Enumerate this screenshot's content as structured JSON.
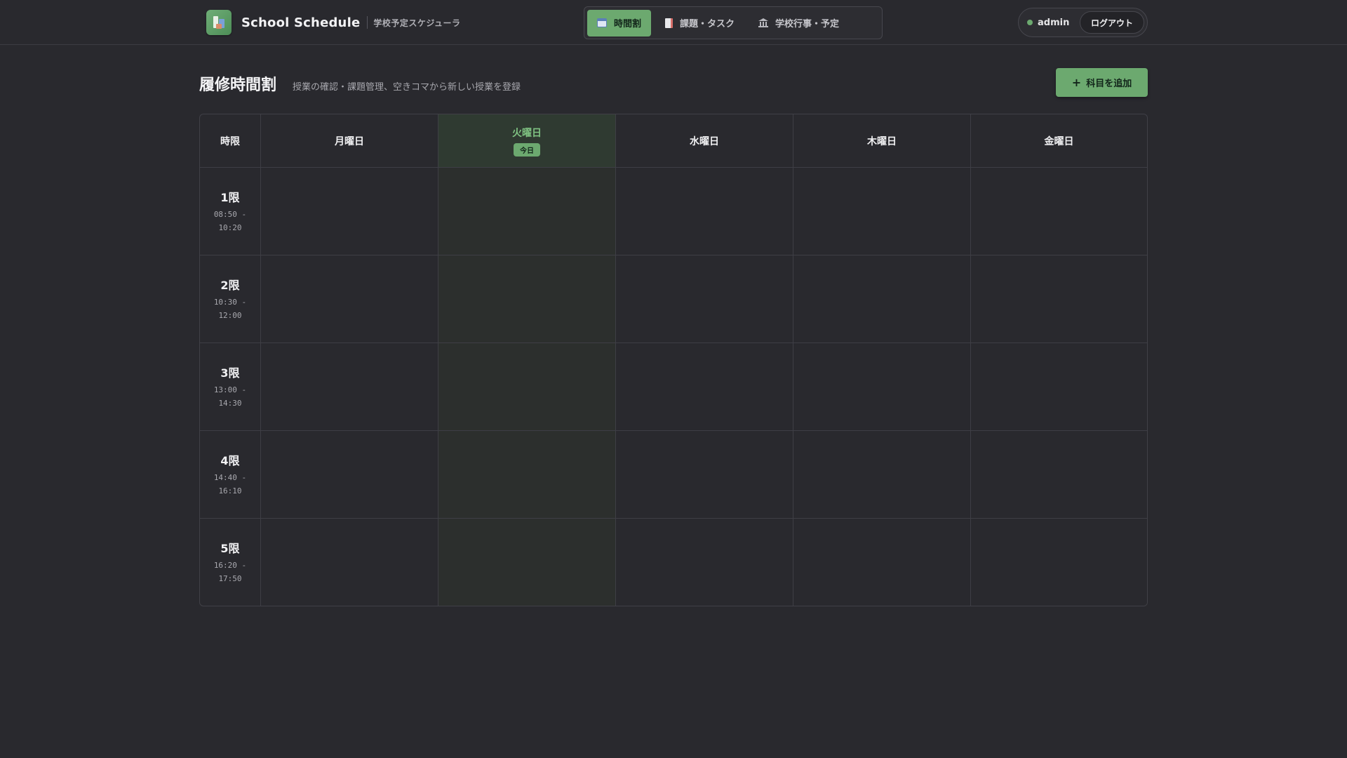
{
  "app": {
    "title": "School Schedule",
    "subtitle": "学校予定スケジューラ"
  },
  "nav": {
    "items": [
      {
        "label": "時間割",
        "icon": "calendar-icon",
        "active": true
      },
      {
        "label": "課題・タスク",
        "icon": "document-icon",
        "active": false
      },
      {
        "label": "学校行事・予定",
        "icon": "building-icon",
        "active": false
      }
    ]
  },
  "user": {
    "name": "admin",
    "logout_label": "ログアウト"
  },
  "page": {
    "title": "履修時間割",
    "description": "授業の確認・課題管理、空きコマから新しい授業を登録",
    "add_button_label": "科目を追加"
  },
  "timetable": {
    "corner_label": "時限",
    "today_label": "今日",
    "days": [
      {
        "label": "月曜日",
        "today": false
      },
      {
        "label": "火曜日",
        "today": true
      },
      {
        "label": "水曜日",
        "today": false
      },
      {
        "label": "木曜日",
        "today": false
      },
      {
        "label": "金曜日",
        "today": false
      }
    ],
    "periods": [
      {
        "name": "1限",
        "start": "08:50 -",
        "end": "10:20"
      },
      {
        "name": "2限",
        "start": "10:30 -",
        "end": "12:00"
      },
      {
        "name": "3限",
        "start": "13:00 -",
        "end": "14:30"
      },
      {
        "name": "4限",
        "start": "14:40 -",
        "end": "16:10"
      },
      {
        "name": "5限",
        "start": "16:20 -",
        "end": "17:50"
      }
    ]
  },
  "colors": {
    "background": "#29292e",
    "accent": "#6ca96f",
    "today_column": "#2f3a31",
    "border": "#3e3e45"
  }
}
